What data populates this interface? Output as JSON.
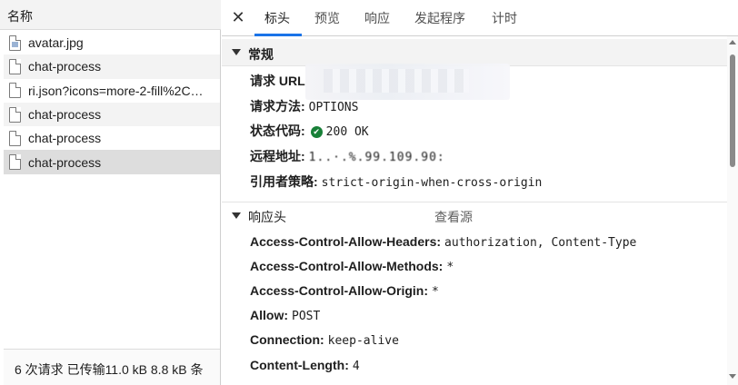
{
  "request_list": {
    "header": "名称",
    "items": [
      {
        "name": "avatar.jpg",
        "icon": "image-file-icon"
      },
      {
        "name": "chat-process",
        "icon": "document-file-icon"
      },
      {
        "name": "ri.json?icons=more-2-fill%2C…",
        "icon": "document-file-icon"
      },
      {
        "name": "chat-process",
        "icon": "document-file-icon"
      },
      {
        "name": "chat-process",
        "icon": "document-file-icon"
      },
      {
        "name": "chat-process",
        "icon": "document-file-icon"
      }
    ],
    "footer": "6 次请求  已传输11.0 kB  8.8 kB 条"
  },
  "tabs": [
    "标头",
    "预览",
    "响应",
    "发起程序",
    "计时"
  ],
  "active_tab": "标头",
  "general": {
    "title": "常规",
    "request_url_label": "请求 URL",
    "request_method_label": "请求方法:",
    "request_method": "OPTIONS",
    "status_code_label": "状态代码:",
    "status_code": "200 OK",
    "remote_address_label": "远程地址:",
    "remote_address": "1..·.%.99.109.90:",
    "referrer_policy_label": "引用者策略:",
    "referrer_policy": "strict-origin-when-cross-origin"
  },
  "response_headers": {
    "title": "响应头",
    "view_source": "查看源",
    "items": [
      {
        "key": "Access-Control-Allow-Headers:",
        "value": "authorization, Content-Type"
      },
      {
        "key": "Access-Control-Allow-Methods:",
        "value": "*"
      },
      {
        "key": "Access-Control-Allow-Origin:",
        "value": "*"
      },
      {
        "key": "Allow:",
        "value": "POST"
      },
      {
        "key": "Connection:",
        "value": "keep-alive"
      },
      {
        "key": "Content-Length:",
        "value": "4"
      }
    ]
  },
  "colors": {
    "tab_underline": "#1a73e8",
    "status_ok": "#188038"
  }
}
